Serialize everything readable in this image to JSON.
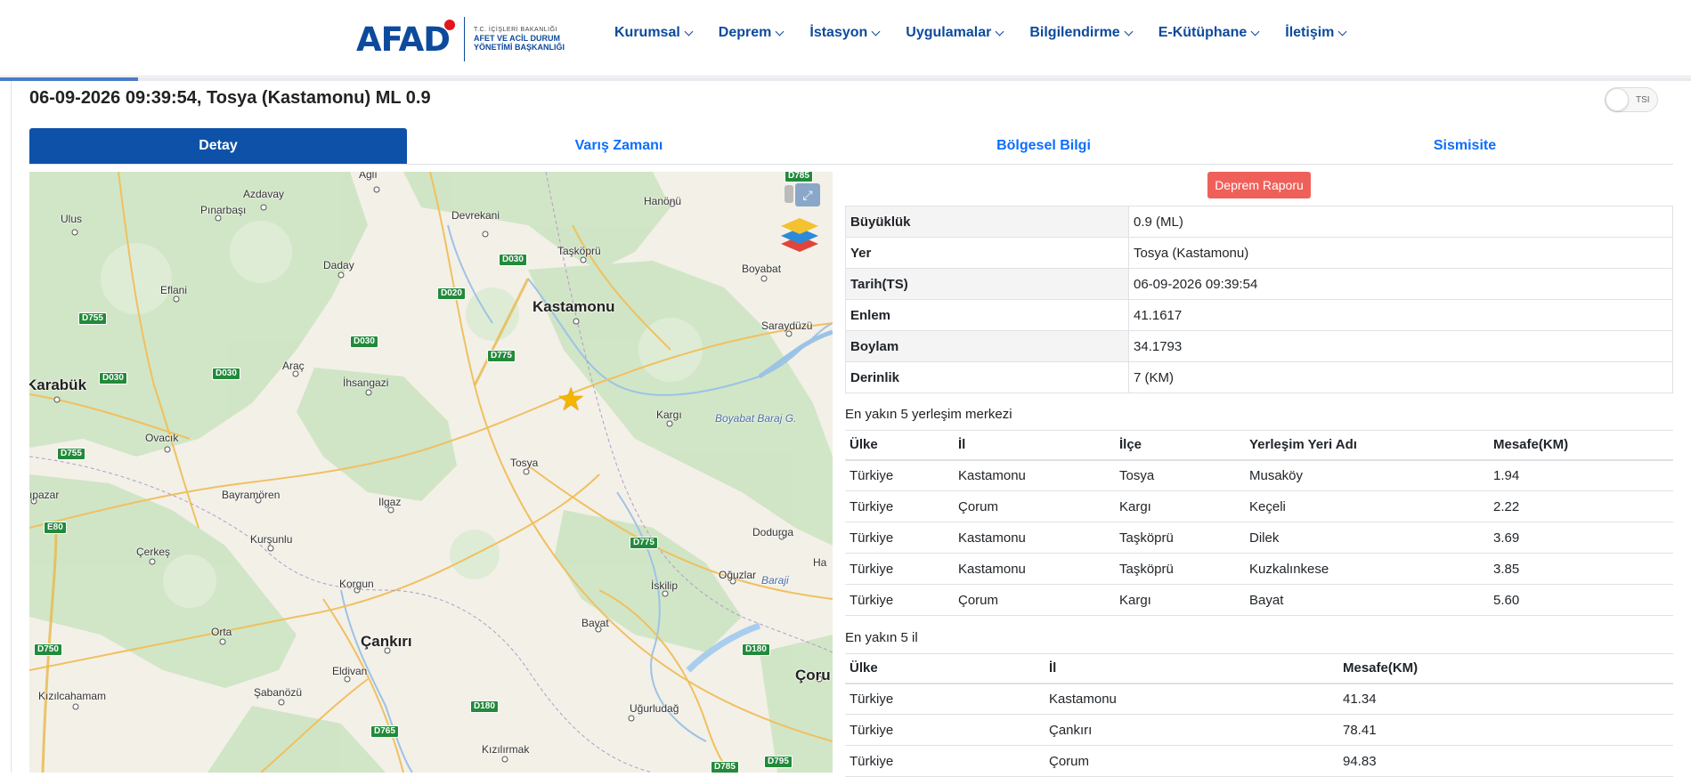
{
  "header": {
    "logo_word": "AFAD",
    "logo_line1": "T.C. İÇİŞLERİ BAKANLIĞI",
    "logo_line2": "AFET VE ACİL DURUM",
    "logo_line3": "YÖNETİMİ BAŞKANLIĞI",
    "nav": [
      "Kurumsal",
      "Deprem",
      "İstasyon",
      "Uygulamalar",
      "Bilgilendirme",
      "E-Kütüphane",
      "İletişim"
    ]
  },
  "page": {
    "title": "06-09-2026 09:39:54, Tosya (Kastamonu) ML 0.9",
    "toggle_label": "TSI",
    "tabs": [
      "Detay",
      "Varış Zamanı",
      "Bölgesel Bilgi",
      "Sismisite"
    ],
    "active_tab": "Detay"
  },
  "map": {
    "places": {
      "agli": "Ağlı",
      "hanonu": "Hanönü",
      "azdavay": "Azdavay",
      "pinarbasi": "Pınarbaşı",
      "devrekani": "Devrekani",
      "ulus": "Ulus",
      "taskopru": "Taşköprü",
      "daday": "Daday",
      "boyabat": "Boyabat",
      "eflani": "Eflani",
      "kastamonu": "Kastamonu",
      "saraydüzü": "Saraydüzü",
      "karabuk": "Karabük",
      "arac": "Araç",
      "ihsangazi": "İhsangazi",
      "kargi": "Kargı",
      "ovacik": "Ovacık",
      "tosya": "Tosya",
      "pazar": "ıpazar",
      "bayramoren": "Bayramören",
      "ilgaz": "Ilgaz",
      "dodurga": "Dodurga",
      "kursunlu": "Kurşunlu",
      "cerkes": "Çerkeş",
      "korgun": "Korgun",
      "iskilip": "İskilip",
      "oguzlar": "Oğuzlar",
      "ha": "Ha",
      "bayat": "Bayat",
      "orta": "Orta",
      "cankiri": "Çankırı",
      "corum": "Çoru",
      "eldivan": "Eldivan",
      "sabanozu": "Şabanözü",
      "kizilcahamam": "Kızılcahamam",
      "ugurludag": "Uğurludağ",
      "kizilirmak": "Kızılırmak",
      "boyabat_baraj": "Boyabat Baraj G.",
      "baraj": "Baraji"
    },
    "roads": {
      "d785_top": "D785",
      "d030_a": "D030",
      "d020": "D020",
      "d755_a": "D755",
      "d030_b": "D030",
      "d775_a": "D775",
      "d030_c": "D030",
      "d030_d": "D030",
      "d755_b": "D755",
      "e80": "E80",
      "d775_b": "D775",
      "d750": "D750",
      "d180_a": "D180",
      "d180_b": "D180",
      "d765": "D765",
      "d785_b": "D785",
      "d795": "D795"
    },
    "expand_icon": "expand-icon",
    "layers_icon": "layers-icon",
    "epicenter_icon": "star-icon"
  },
  "report_button": "Deprem Raporu",
  "details": [
    {
      "k": "Büyüklük",
      "v": "0.9 (ML)"
    },
    {
      "k": "Yer",
      "v": "Tosya (Kastamonu)"
    },
    {
      "k": "Tarih(TS)",
      "v": "06-09-2026 09:39:54"
    },
    {
      "k": "Enlem",
      "v": "41.1617"
    },
    {
      "k": "Boylam",
      "v": "34.1793"
    },
    {
      "k": "Derinlik",
      "v": "7 (KM)"
    }
  ],
  "nearest_settlements": {
    "title": "En yakın 5 yerleşim merkezi",
    "headers": [
      "Ülke",
      "İl",
      "İlçe",
      "Yerleşim Yeri Adı",
      "Mesafe(KM)"
    ],
    "rows": [
      [
        "Türkiye",
        "Kastamonu",
        "Tosya",
        "Musaköy",
        "1.94"
      ],
      [
        "Türkiye",
        "Çorum",
        "Kargı",
        "Keçeli",
        "2.22"
      ],
      [
        "Türkiye",
        "Kastamonu",
        "Taşköprü",
        "Dilek",
        "3.69"
      ],
      [
        "Türkiye",
        "Kastamonu",
        "Taşköprü",
        "Kuzkalınkese",
        "3.85"
      ],
      [
        "Türkiye",
        "Çorum",
        "Kargı",
        "Bayat",
        "5.60"
      ]
    ]
  },
  "nearest_provinces": {
    "title": "En yakın 5 il",
    "headers": [
      "Ülke",
      "İl",
      "Mesafe(KM)"
    ],
    "rows": [
      [
        "Türkiye",
        "Kastamonu",
        "41.34"
      ],
      [
        "Türkiye",
        "Çankırı",
        "78.41"
      ],
      [
        "Türkiye",
        "Çorum",
        "94.83"
      ]
    ]
  },
  "colors": {
    "brand_blue": "#0d4a9c",
    "tab_active": "#0d52a8",
    "link_blue": "#0d6efd",
    "report_red": "#f0605a",
    "forest_green": "#cfe5c4",
    "road_yellow": "#f0c060"
  }
}
